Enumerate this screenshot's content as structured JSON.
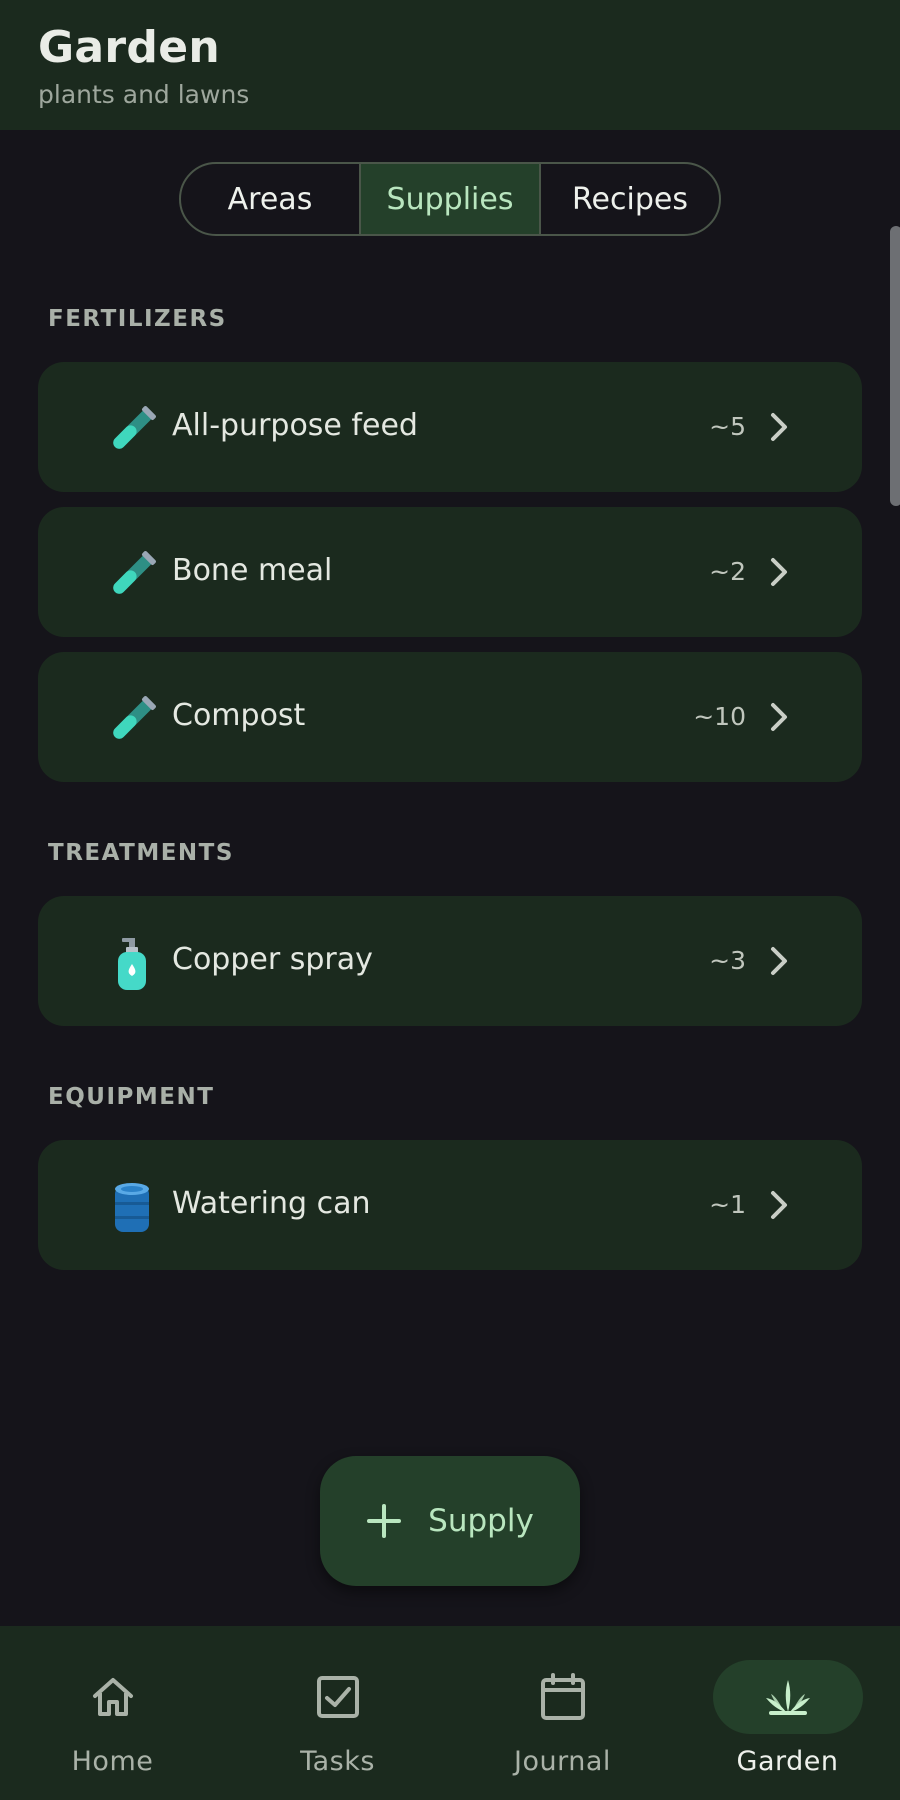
{
  "header": {
    "title": "Garden",
    "subtitle": "plants and lawns"
  },
  "tabs": [
    {
      "label": "Areas",
      "active": false
    },
    {
      "label": "Supplies",
      "active": true
    },
    {
      "label": "Recipes",
      "active": false
    }
  ],
  "sections": [
    {
      "label": "FERTILIZERS",
      "items": [
        {
          "name": "All-purpose feed",
          "count": "~5",
          "icon": "test-tube-icon"
        },
        {
          "name": "Bone meal",
          "count": "~2",
          "icon": "test-tube-icon"
        },
        {
          "name": "Compost",
          "count": "~10",
          "icon": "test-tube-icon"
        }
      ]
    },
    {
      "label": "TREATMENTS",
      "items": [
        {
          "name": "Copper spray",
          "count": "~3",
          "icon": "spray-bottle-icon"
        }
      ]
    },
    {
      "label": "EQUIPMENT",
      "items": [
        {
          "name": "Watering can",
          "count": "~1",
          "icon": "barrel-icon"
        }
      ]
    }
  ],
  "fab": {
    "label": "Supply",
    "icon": "plus-icon"
  },
  "nav": [
    {
      "label": "Home",
      "icon": "home-icon",
      "active": false
    },
    {
      "label": "Tasks",
      "icon": "checkbox-icon",
      "active": false
    },
    {
      "label": "Journal",
      "icon": "calendar-icon",
      "active": false
    },
    {
      "label": "Garden",
      "icon": "plant-icon",
      "active": true
    }
  ],
  "colors": {
    "background": "#15141a",
    "surface": "#1b2a1e",
    "accent_container": "#24402a",
    "accent_text": "#b9e6bf"
  }
}
